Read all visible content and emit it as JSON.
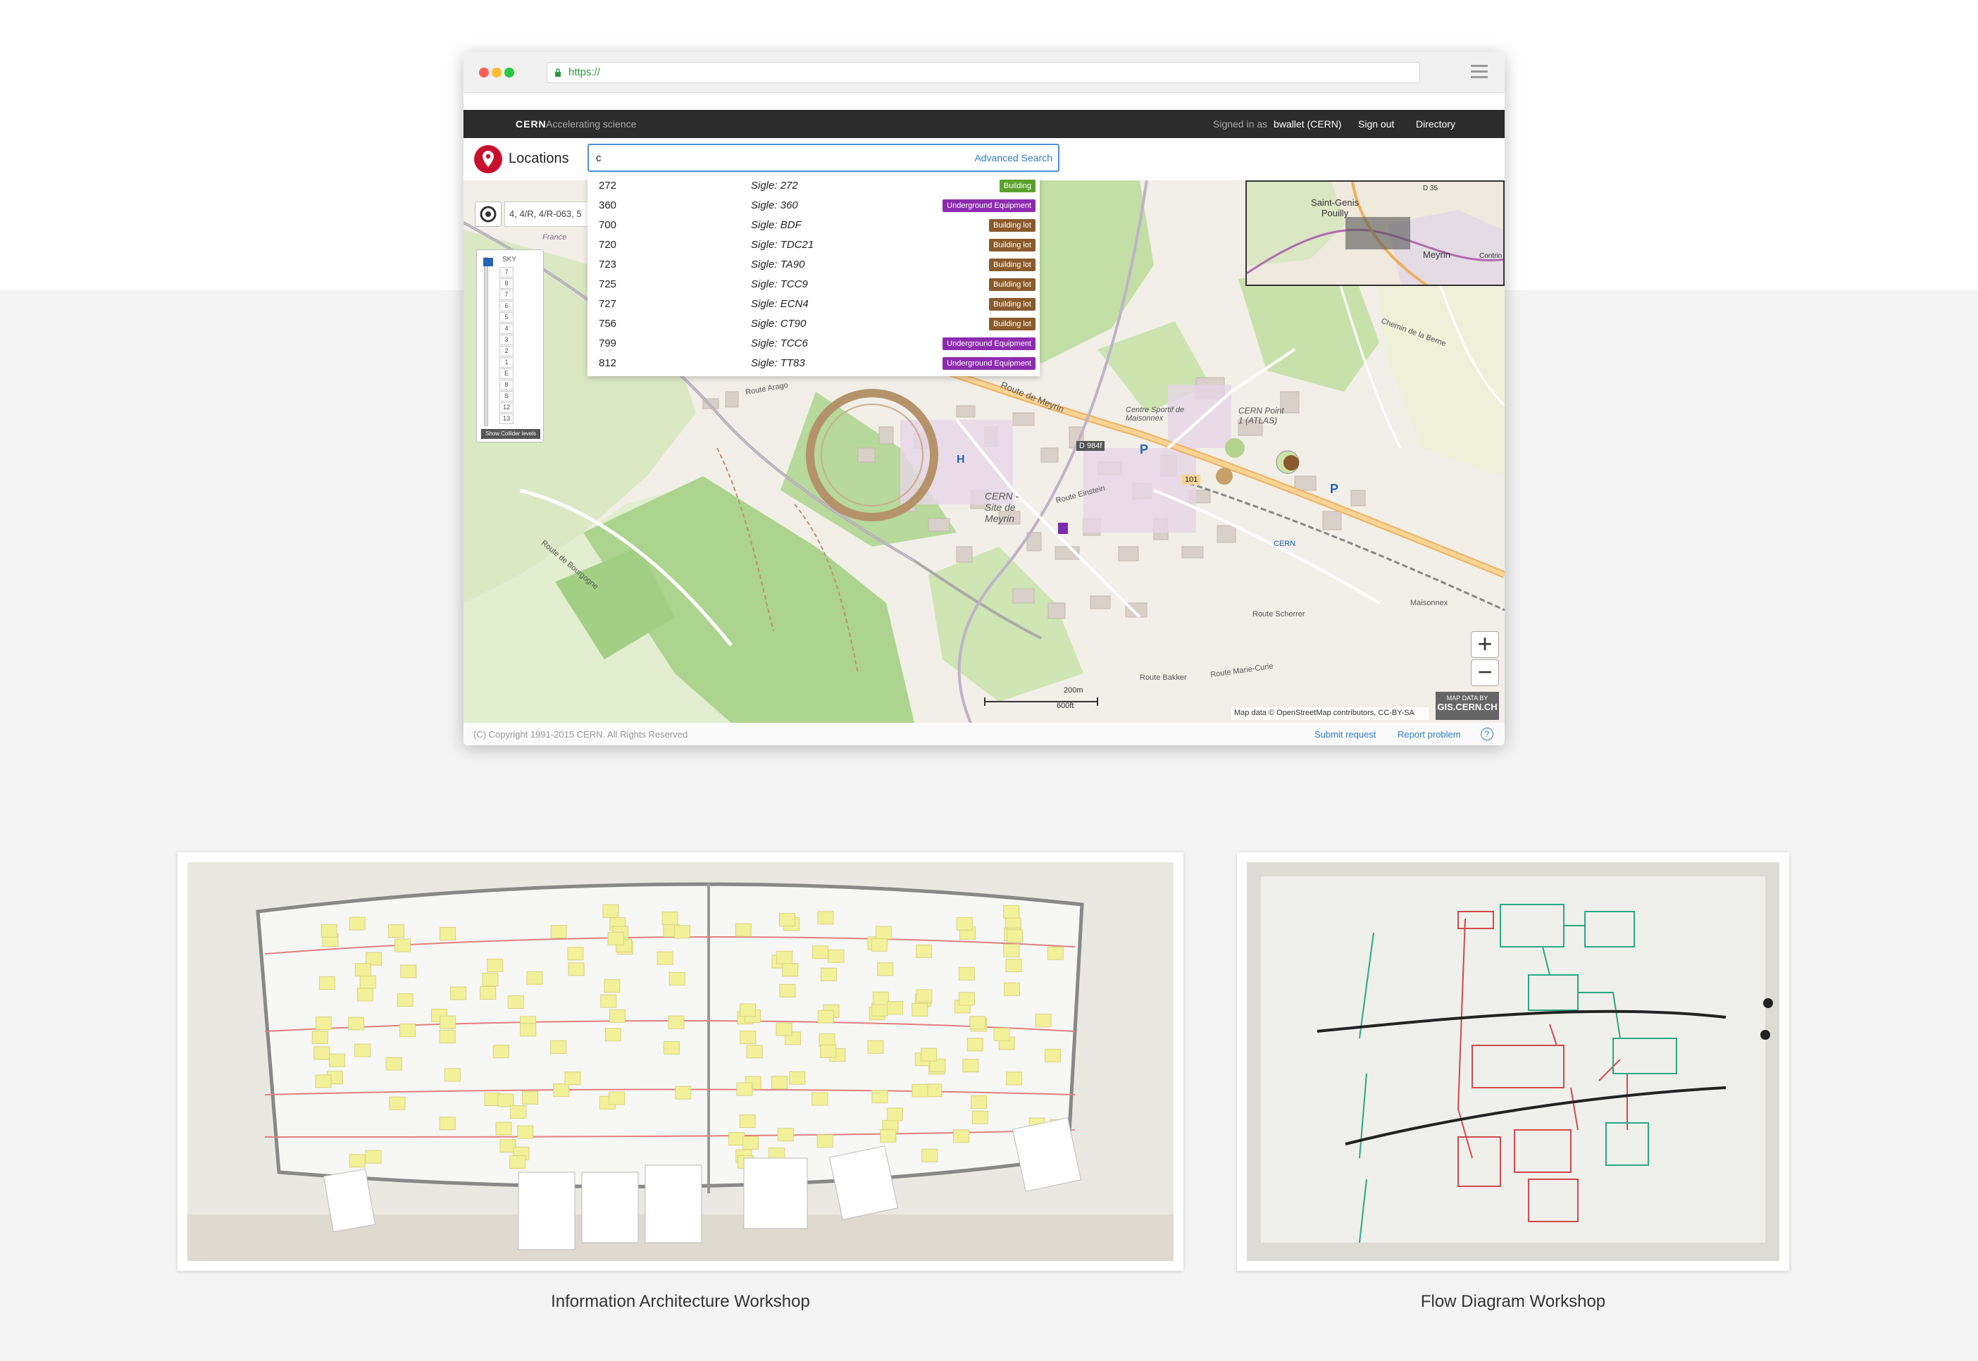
{
  "browser": {
    "url": "https://",
    "traffic_colors": [
      "#ff5f57",
      "#febc2e",
      "#28c840"
    ]
  },
  "header": {
    "brand": "CERN",
    "tagline": "Accelerating science",
    "signed_in_label": "Signed in as",
    "user": "bwallet (CERN)",
    "sign_out": "Sign out",
    "directory": "Directory"
  },
  "app": {
    "title": "Locations",
    "search_value": "c",
    "advanced_search": "Advanced Search"
  },
  "results": [
    {
      "number": "272",
      "sigle": "Sigle: 272",
      "type": "Building"
    },
    {
      "number": "360",
      "sigle": "Sigle: 360",
      "type": "Underground Equipment"
    },
    {
      "number": "700",
      "sigle": "Sigle: BDF",
      "type": "Building lot"
    },
    {
      "number": "720",
      "sigle": "Sigle: TDC21",
      "type": "Building lot"
    },
    {
      "number": "723",
      "sigle": "Sigle: TA90",
      "type": "Building lot"
    },
    {
      "number": "725",
      "sigle": "Sigle: TCC9",
      "type": "Building lot"
    },
    {
      "number": "727",
      "sigle": "Sigle: ECN4",
      "type": "Building lot"
    },
    {
      "number": "756",
      "sigle": "Sigle: CT90",
      "type": "Building lot"
    },
    {
      "number": "799",
      "sigle": "Sigle: TCC6",
      "type": "Underground Equipment"
    },
    {
      "number": "812",
      "sigle": "Sigle: TT83",
      "type": "Underground Equipment"
    }
  ],
  "badge_colors": {
    "Building": "#5aa02c",
    "Underground Equipment": "#8d2bb0",
    "Building lot": "#8a5a2b"
  },
  "map": {
    "breadcrumb": "4, 4/R, 4/R-063, 5",
    "level_header": "SKY",
    "levels": [
      "7",
      "8",
      "7",
      "6",
      "5",
      "4",
      "3",
      "2",
      "1",
      "E",
      "8",
      "S",
      "12",
      "13"
    ],
    "show_levels_button": "Show Collider levels",
    "labels": {
      "route_de_meyrin": "Route de Meyrin",
      "cern_site": "CERN - Site de Meyrin",
      "point1": "CERN Point 1 (ATLAS)",
      "sport": "Centre Sportif de Maisonnex",
      "d984f": "D 984f",
      "r101": "101",
      "route_arago": "Route Arago",
      "route_de_bourgogne": "Route de Bourgogne",
      "route_scherrer": "Route Scherrer",
      "route_marie_curie": "Route Marie-Curie",
      "route_einstein": "Route Einstein",
      "chemin_de_la_berne": "Chemin de la Berne",
      "maisonnex": "Maisonnex",
      "route_bakker": "Route Bakker",
      "cern_tram": "CERN",
      "france": "France"
    },
    "minimap_labels": {
      "saint_genis": "Saint-Genis Pouilly",
      "meyrin": "Meyrin",
      "d35": "D 35",
      "contrin": "Contrin"
    },
    "scale_top": "200m",
    "scale_bottom": "600ft",
    "attribution": "Map data © OpenStreetMap contributors, CC-BY-SA",
    "map_data_by": "MAP DATA BY",
    "gis": "GIS.CERN.CH",
    "zoom_in": "+",
    "zoom_out": "−"
  },
  "footer": {
    "copyright": "(C) Copyright 1991-2015 CERN. All Rights Reserved",
    "submit_request": "Submit request",
    "report_problem": "Report problem",
    "help": "?"
  },
  "photos": {
    "ia_caption": "Information Architecture Workshop",
    "flow_caption": "Flow Diagram Workshop"
  }
}
